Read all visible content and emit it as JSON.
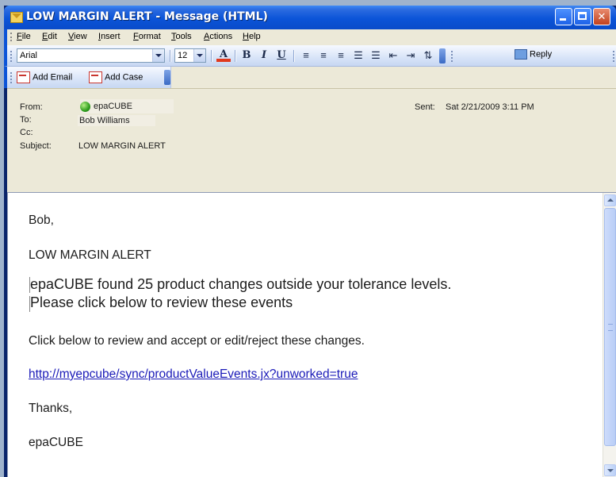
{
  "window": {
    "title": "LOW MARGIN ALERT - Message (HTML)"
  },
  "menu": [
    "File",
    "Edit",
    "View",
    "Insert",
    "Format",
    "Tools",
    "Actions",
    "Help"
  ],
  "format_toolbar": {
    "font": "Arial",
    "size": "12",
    "color_glyph": "A",
    "bold": "B",
    "italic": "I",
    "underline": "U",
    "reply_label": "Reply"
  },
  "custom_toolbar": {
    "add_email": "Add Email",
    "add_case": "Add Case"
  },
  "header": {
    "from_label": "From:",
    "from_value": "epaCUBE",
    "to_label": "To:",
    "to_value": "Bob Williams",
    "cc_label": "Cc:",
    "subject_label": "Subject:",
    "subject_value": "LOW MARGIN ALERT",
    "sent_label": "Sent:",
    "sent_value": "Sat 2/21/2009 3:11 PM"
  },
  "body": {
    "greeting": "Bob,",
    "alert_title": "LOW MARGIN ALERT",
    "line1": "epaCUBE found 25 product changes outside your tolerance levels.",
    "line2": "Please click below to review these events",
    "instruction": "Click below to review and accept or edit/reject these changes.",
    "link": "http://myepcube/sync/productValueEvents.jx?unworked=true",
    "thanks": "Thanks,",
    "signature": "epaCUBE"
  },
  "colors": {
    "titlebar": "#0b54d8",
    "link": "#1a1ab8",
    "header_bg": "#ece9d8"
  }
}
